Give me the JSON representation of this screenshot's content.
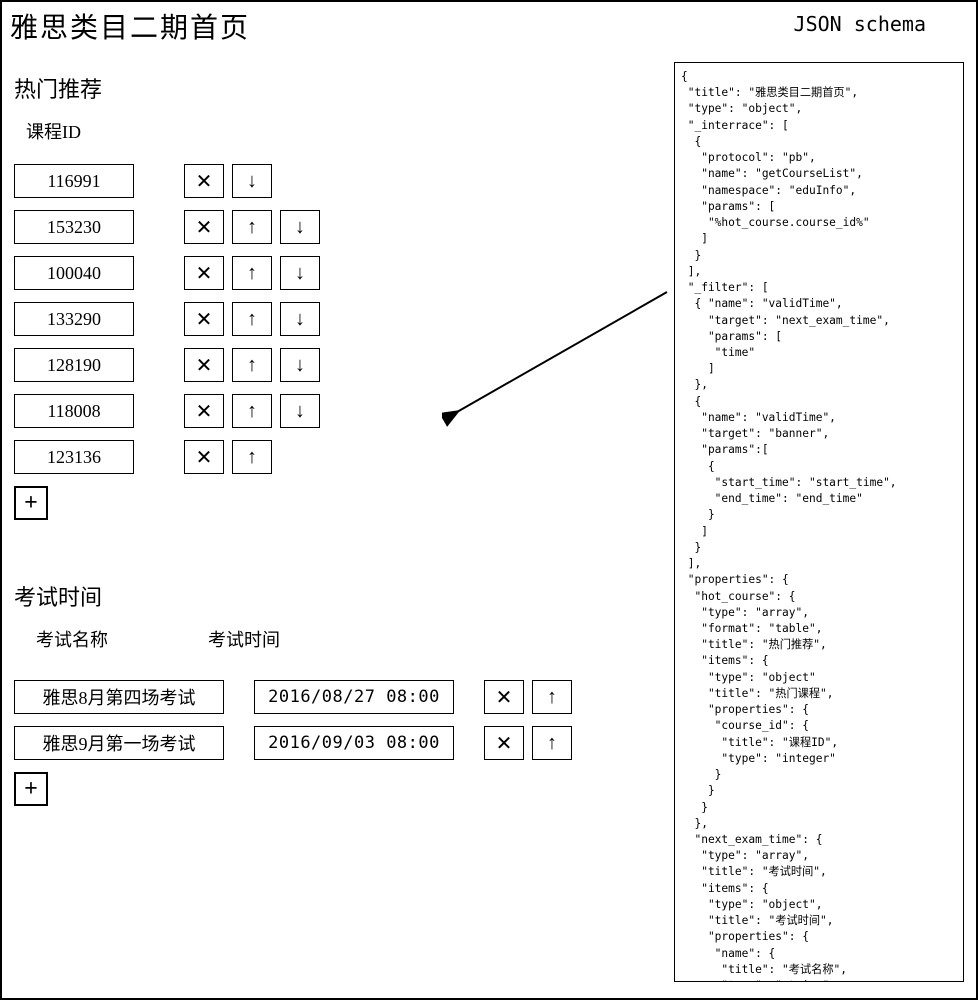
{
  "page_title": "雅思类目二期首页",
  "schema_label": "JSON schema",
  "hot_course": {
    "section_title": "热门推荐",
    "column_label": "课程ID",
    "rows": [
      {
        "id": "116991",
        "has_up": false,
        "has_down": true
      },
      {
        "id": "153230",
        "has_up": true,
        "has_down": true
      },
      {
        "id": "100040",
        "has_up": true,
        "has_down": true
      },
      {
        "id": "133290",
        "has_up": true,
        "has_down": true
      },
      {
        "id": "128190",
        "has_up": true,
        "has_down": true
      },
      {
        "id": "118008",
        "has_up": true,
        "has_down": true
      },
      {
        "id": "123136",
        "has_up": true,
        "has_down": false
      }
    ],
    "add_label": "+"
  },
  "exam_time": {
    "section_title": "考试时间",
    "col_name": "考试名称",
    "col_time": "考试时间",
    "rows": [
      {
        "name": "雅思8月第四场考试",
        "time": "2016/08/27 08:00"
      },
      {
        "name": "雅思9月第一场考试",
        "time": "2016/09/03 08:00"
      }
    ],
    "add_label": "+"
  },
  "glyph": {
    "x": "✕",
    "up": "↑",
    "down": "↓"
  },
  "schema_text": "{\n \"title\": \"雅思类目二期首页\",\n \"type\": \"object\",\n \"_interrace\": [\n  {\n   \"protocol\": \"pb\",\n   \"name\": \"getCourseList\",\n   \"namespace\": \"eduInfo\",\n   \"params\": [\n    \"%hot_course.course_id%\"\n   ]\n  }\n ],\n \"_filter\": [\n  { \"name\": \"validTime\",\n    \"target\": \"next_exam_time\",\n    \"params\": [\n     \"time\"\n    ]\n  },\n  {\n   \"name\": \"validTime\",\n   \"target\": \"banner\",\n   \"params\":[\n    {\n     \"start_time\": \"start_time\",\n     \"end_time\": \"end_time\"\n    }\n   ]\n  }\n ],\n \"properties\": {\n  \"hot_course\": {\n   \"type\": \"array\",\n   \"format\": \"table\",\n   \"title\": \"热门推荐\",\n   \"items\": {\n    \"type\": \"object\"\n    \"title\": \"热门课程\",\n    \"properties\": {\n     \"course_id\": {\n      \"title\": \"课程ID\",\n      \"type\": \"integer\"\n     }\n    }\n   }\n  },\n  \"next_exam_time\": {\n   \"type\": \"array\",\n   \"title\": \"考试时间\",\n   \"items\": {\n    \"type\": \"object\",\n    \"title\": \"考试时间\",\n    \"properties\": {\n     \"name\": {\n      \"title\": \"考试名称\",\n      \"type\": \"string\"\n     },"
}
